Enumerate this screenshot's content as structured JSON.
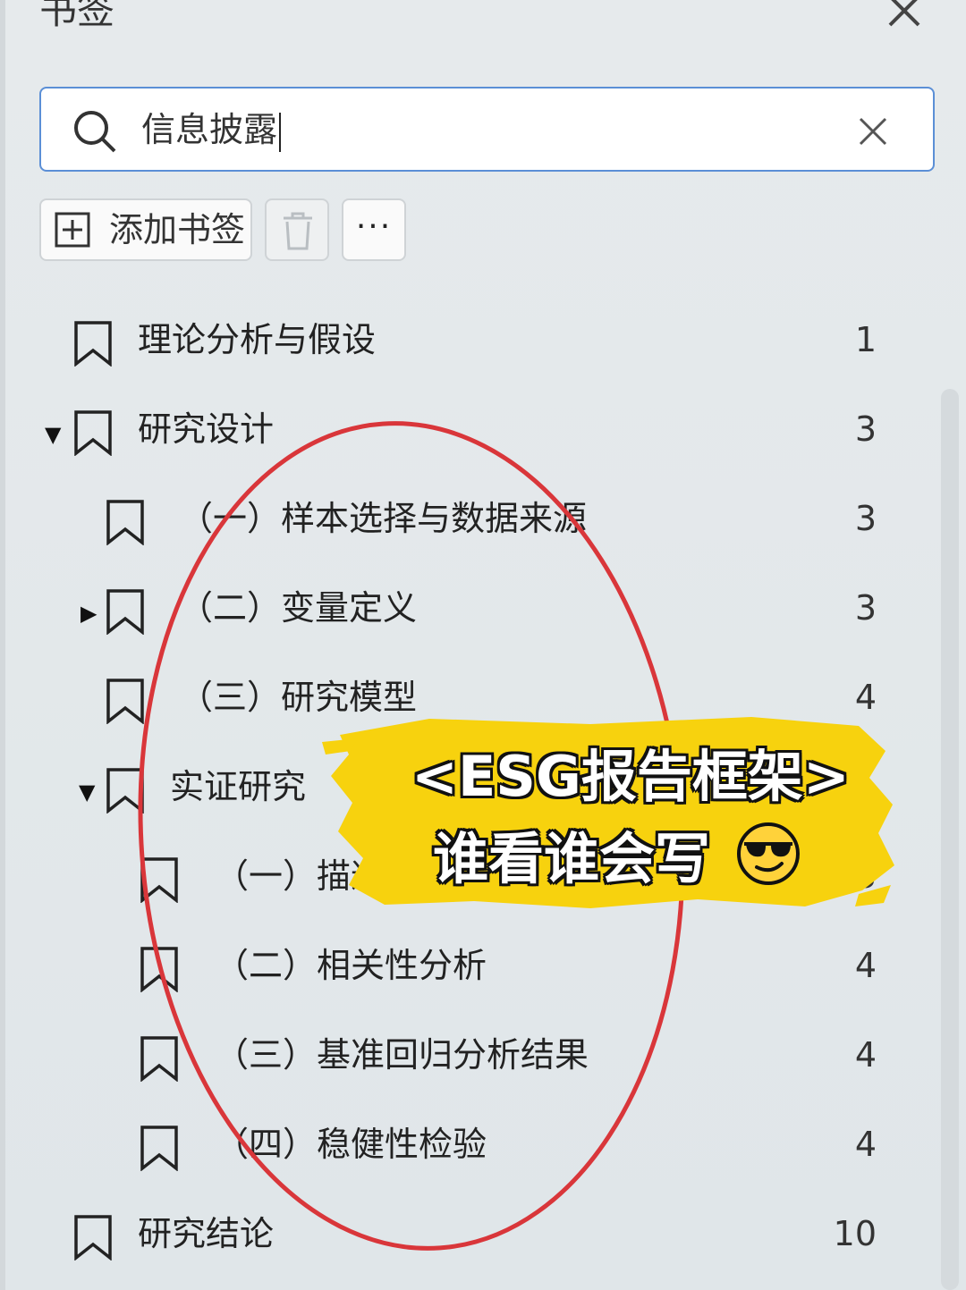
{
  "panel": {
    "title": "书签",
    "close_icon": "close-icon"
  },
  "search": {
    "value": "信息披露",
    "search_icon": "search-icon",
    "clear_icon": "clear-icon"
  },
  "toolbar": {
    "add_label": "添加书签",
    "add_icon": "add-bookmark-icon",
    "delete_icon": "trash-icon",
    "more_label": "···"
  },
  "bookmarks": [
    {
      "label": "理论分析与假设",
      "page": "1"
    },
    {
      "label": "研究设计",
      "page": "3",
      "expanded": true
    },
    {
      "label": "（一）样本选择与数据来源",
      "page": "3"
    },
    {
      "label": "（二）变量定义",
      "page": "3",
      "expanded": false
    },
    {
      "label": "（三）研究模型",
      "page": "4"
    },
    {
      "label": "实证研究",
      "page": "",
      "expanded": true
    },
    {
      "label": "（一）描述性",
      "page": "3"
    },
    {
      "label": "（二）相关性分析",
      "page": "4"
    },
    {
      "label": "（三）基准回归分析结果",
      "page": "4"
    },
    {
      "label": "（四）稳健性检验",
      "page": "4"
    },
    {
      "label": "研究结论",
      "page": "10"
    }
  ],
  "overlay": {
    "line1": "<ESG报告框架>",
    "line2": "谁看谁会写",
    "emoji": "smiling-face-with-sunglasses",
    "highlight_color": "#f7d20e",
    "circle_color": "#d9363a"
  }
}
